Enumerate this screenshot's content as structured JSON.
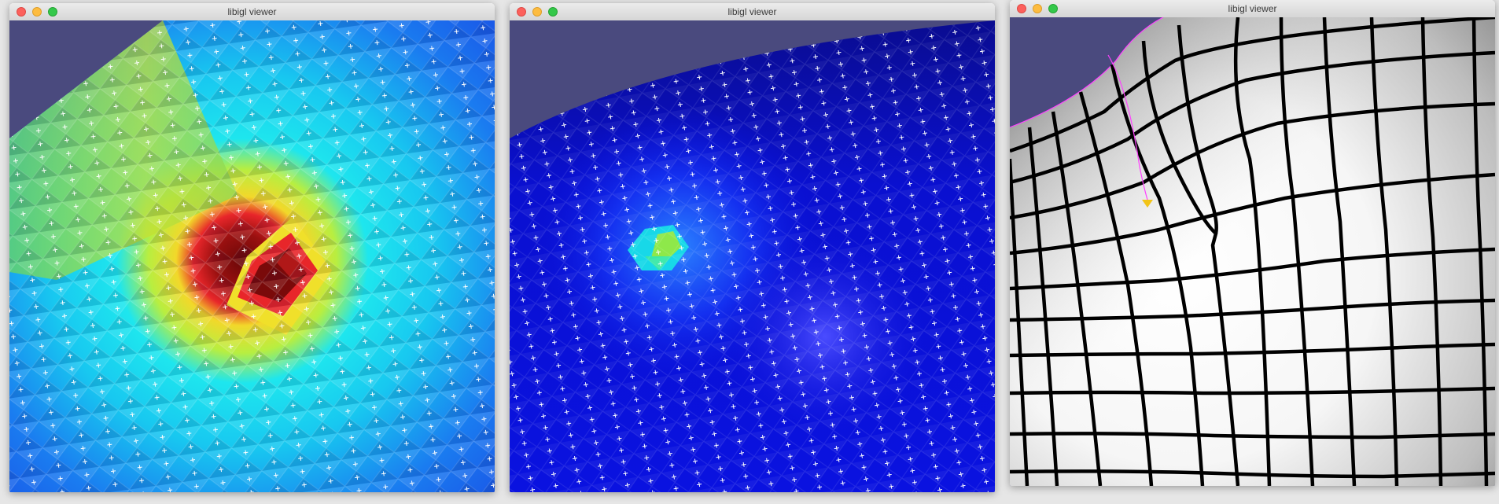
{
  "windows": [
    {
      "title": "libigl viewer",
      "view": "scalar-field-jet",
      "background_color": "#4a4a7e"
    },
    {
      "title": "libigl viewer",
      "view": "scalar-field-blue",
      "background_color": "#4a4a7e"
    },
    {
      "title": "libigl viewer",
      "view": "parametrization-grid",
      "background_color": "#4a4a7e"
    }
  ],
  "colors": {
    "jet_peak": "#7a0a0a",
    "jet_red": "#e8262a",
    "jet_yellow": "#f2e82a",
    "jet_cyan": "#18e8f0",
    "jet_blue": "#1a6af0",
    "deep_blue": "#0a10d8",
    "cross_marks": "#ffffff",
    "grid_lines": "#000000",
    "selection_line": "#ff40ff",
    "handle": "#f2c418"
  },
  "icons": [
    "close-icon",
    "minimize-icon",
    "zoom-icon"
  ]
}
